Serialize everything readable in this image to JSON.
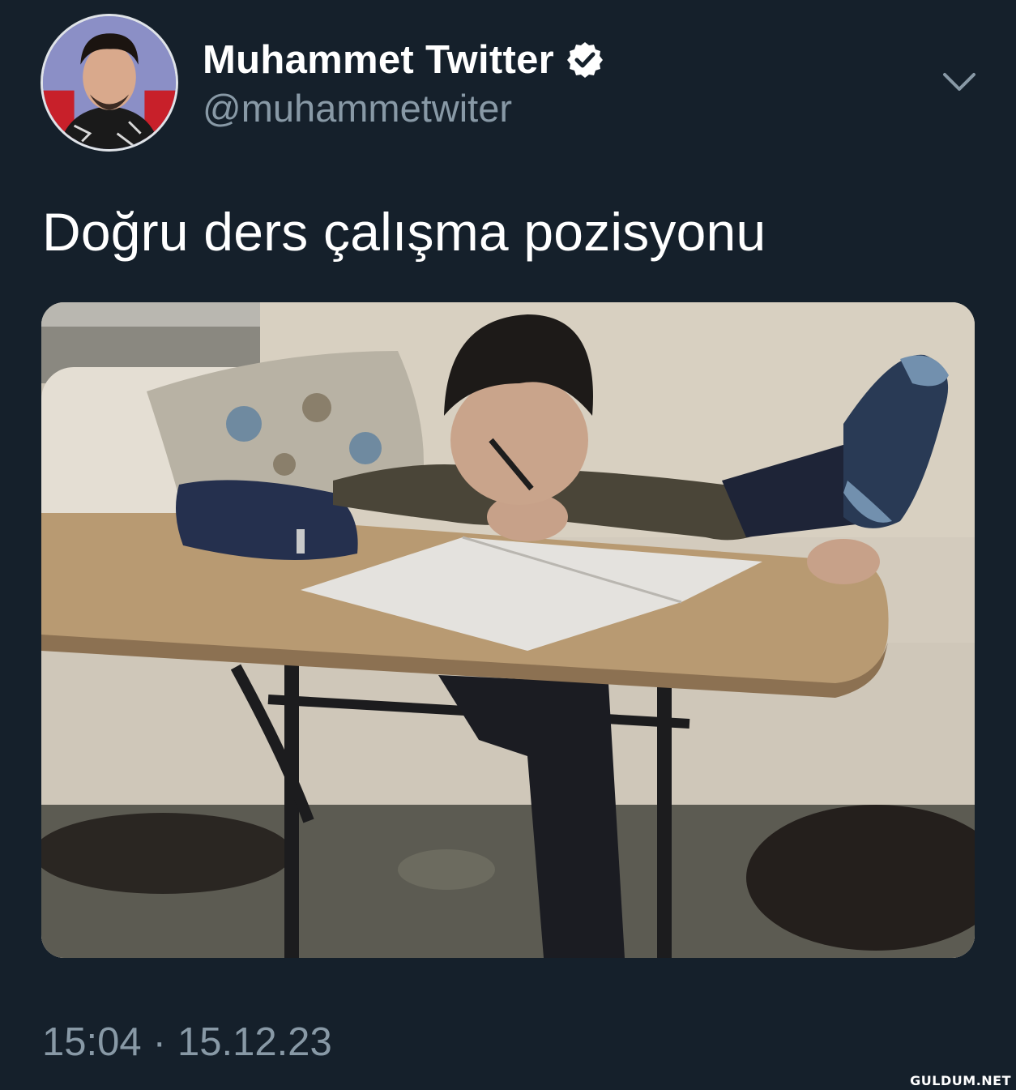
{
  "tweet": {
    "author": {
      "display_name": "Muhammet Twitter",
      "handle": "@muhammetwiter",
      "verified": true,
      "avatar_icon": "avatar-photo"
    },
    "menu_icon": "chevron-down-icon",
    "text": "Doğru ders çalışma pozisyonu",
    "media": {
      "type": "photo"
    },
    "time": "15:04",
    "separator": "·",
    "date": "15.12.23"
  },
  "watermark": "GULDUM.NET",
  "colors": {
    "background": "#15202b",
    "primary_text": "#ffffff",
    "secondary_text": "#8899a6",
    "verified_badge": "#ffffff"
  }
}
